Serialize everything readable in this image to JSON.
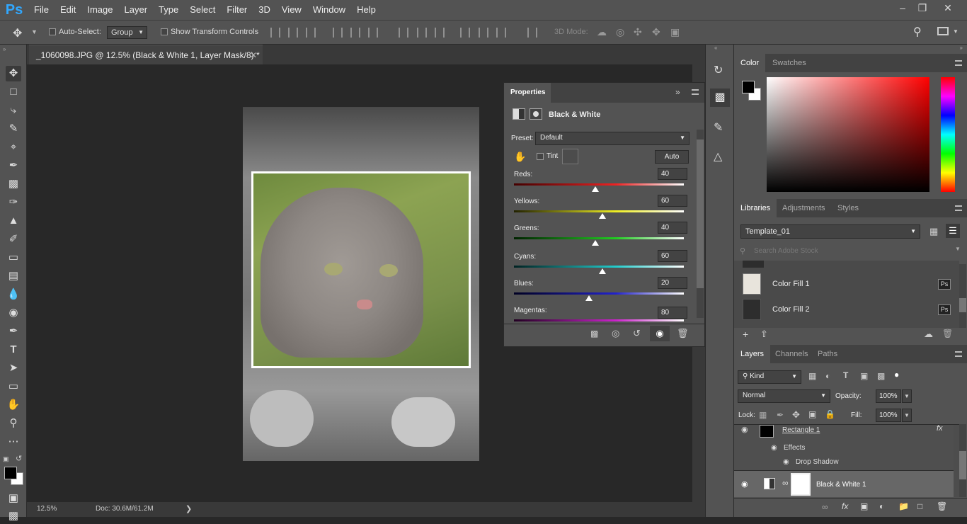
{
  "app": {
    "logo": "Ps"
  },
  "menu": [
    "File",
    "Edit",
    "Image",
    "Layer",
    "Type",
    "Select",
    "Filter",
    "3D",
    "View",
    "Window",
    "Help"
  ],
  "options": {
    "auto_select_label": "Auto-Select:",
    "auto_select_value": "Group",
    "show_transform_label": "Show Transform Controls",
    "mode_3d_label": "3D Mode:"
  },
  "document": {
    "tab_title": "_1060098.JPG @ 12.5% (Black & White 1, Layer Mask/8) *",
    "zoom": "12.5%",
    "doc_info": "Doc: 30.6M/61.2M"
  },
  "properties": {
    "tab": "Properties",
    "title": "Black & White",
    "preset_label": "Preset:",
    "preset_value": "Default",
    "tint_label": "Tint",
    "auto_label": "Auto",
    "sliders": [
      {
        "label": "Reds:",
        "value": "40"
      },
      {
        "label": "Yellows:",
        "value": "60"
      },
      {
        "label": "Greens:",
        "value": "40"
      },
      {
        "label": "Cyans:",
        "value": "60"
      },
      {
        "label": "Blues:",
        "value": "20"
      },
      {
        "label": "Magentas:",
        "value": "80"
      }
    ]
  },
  "color_panel": {
    "tabs": [
      "Color",
      "Swatches"
    ]
  },
  "libraries": {
    "tabs": [
      "Libraries",
      "Adjustments",
      "Styles"
    ],
    "library_name": "Template_01",
    "search_placeholder": "Search Adobe Stock",
    "items": [
      {
        "name": "Color Fill 1",
        "badge": "Ps"
      },
      {
        "name": "Color Fill 2",
        "badge": "Ps"
      }
    ]
  },
  "layers": {
    "tabs": [
      "Layers",
      "Channels",
      "Paths"
    ],
    "filter_kind": "Kind",
    "blend_mode": "Normal",
    "opacity_label": "Opacity:",
    "opacity_value": "100%",
    "lock_label": "Lock:",
    "fill_label": "Fill:",
    "fill_value": "100%",
    "items": {
      "rect": "Rectangle 1",
      "effects": "Effects",
      "drop_shadow": "Drop Shadow",
      "bw": "Black & White 1"
    },
    "fx": "fx"
  }
}
